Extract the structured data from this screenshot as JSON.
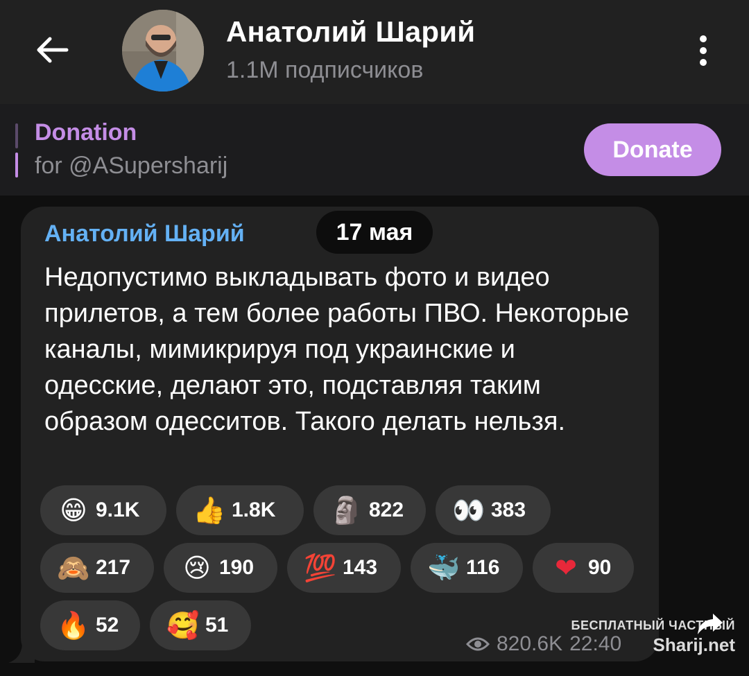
{
  "header": {
    "title": "Анатолий Шарий",
    "subtitle": "1.1M подписчиков",
    "back_icon": "arrow-left-icon",
    "menu_icon": "more-vertical-icon"
  },
  "pinned": {
    "title": "Donation",
    "text": "for @ASupersharij",
    "button_label": "Donate"
  },
  "message": {
    "author": "Анатолий Шарий",
    "date": "17 мая",
    "text": "Недопустимо выкладывать фото и видео прилетов, а тем более работы ПВО. Некоторые каналы, мимикрируя под украинские и одесские, делают это, подставляя таким образом одесситов. Такого делать нельзя.",
    "reactions": [
      {
        "emoji": "😁",
        "count": "9.1K"
      },
      {
        "emoji": "👍",
        "count": "1.8K"
      },
      {
        "emoji": "🗿",
        "count": "822"
      },
      {
        "emoji": "👀",
        "count": "383"
      },
      {
        "emoji": "🙈",
        "count": "217"
      },
      {
        "emoji": "😢",
        "count": "190"
      },
      {
        "emoji": "💯",
        "count": "143"
      },
      {
        "emoji": "🐳",
        "count": "116"
      },
      {
        "emoji": "❤",
        "count": "90"
      },
      {
        "emoji": "🔥",
        "count": "52"
      },
      {
        "emoji": "🥰",
        "count": "51"
      }
    ],
    "views": "820.6K",
    "time": "22:40",
    "share_icon": "share-arrow-icon"
  },
  "watermark": {
    "line1": "БЕСПЛАТНЫЙ ЧАСТНЫЙ",
    "line2": "Sharij.net"
  },
  "colors": {
    "accent": "#c48de6",
    "author": "#64b1f4",
    "header_bg": "#212121",
    "bubble_bg": "#222222",
    "reaction_bg": "#383838"
  }
}
